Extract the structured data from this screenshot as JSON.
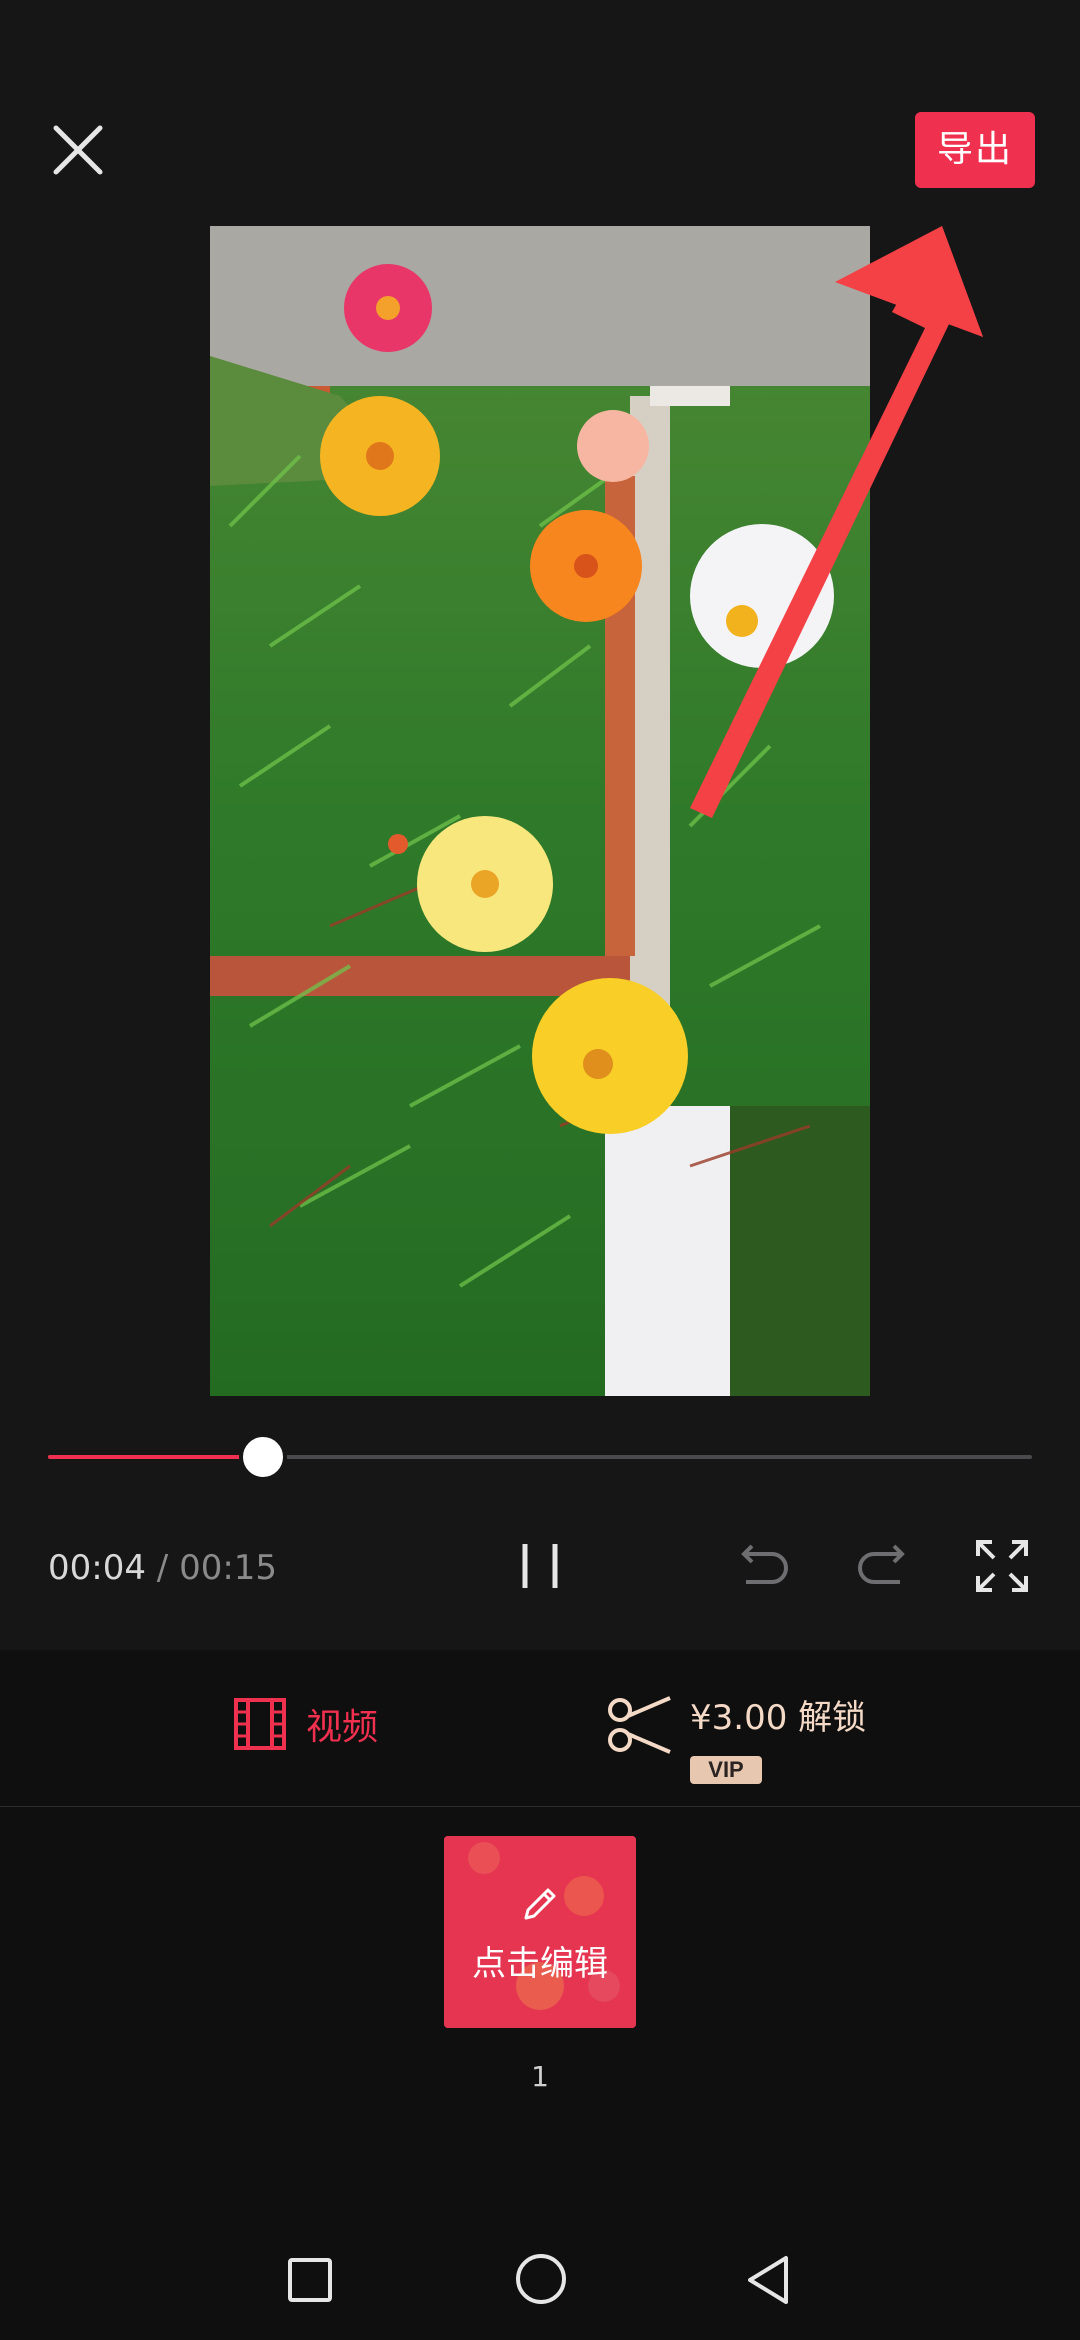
{
  "header": {
    "close_icon": "close-icon",
    "export_label": "导出"
  },
  "player": {
    "current_time": "00:04",
    "separator": "/",
    "total_time": "00:15",
    "progress_fraction": 0.216,
    "icons": [
      "pause-icon",
      "undo-icon",
      "redo-icon",
      "fullscreen-icon"
    ]
  },
  "tabs": {
    "video_label": "视频",
    "unlock_label": "¥3.00 解锁",
    "vip_badge": "VIP"
  },
  "clips": [
    {
      "label": "点击编辑",
      "index": "1"
    }
  ],
  "colors": {
    "accent": "#f0304f",
    "vip": "#e7c7b0",
    "background": "#161617"
  }
}
